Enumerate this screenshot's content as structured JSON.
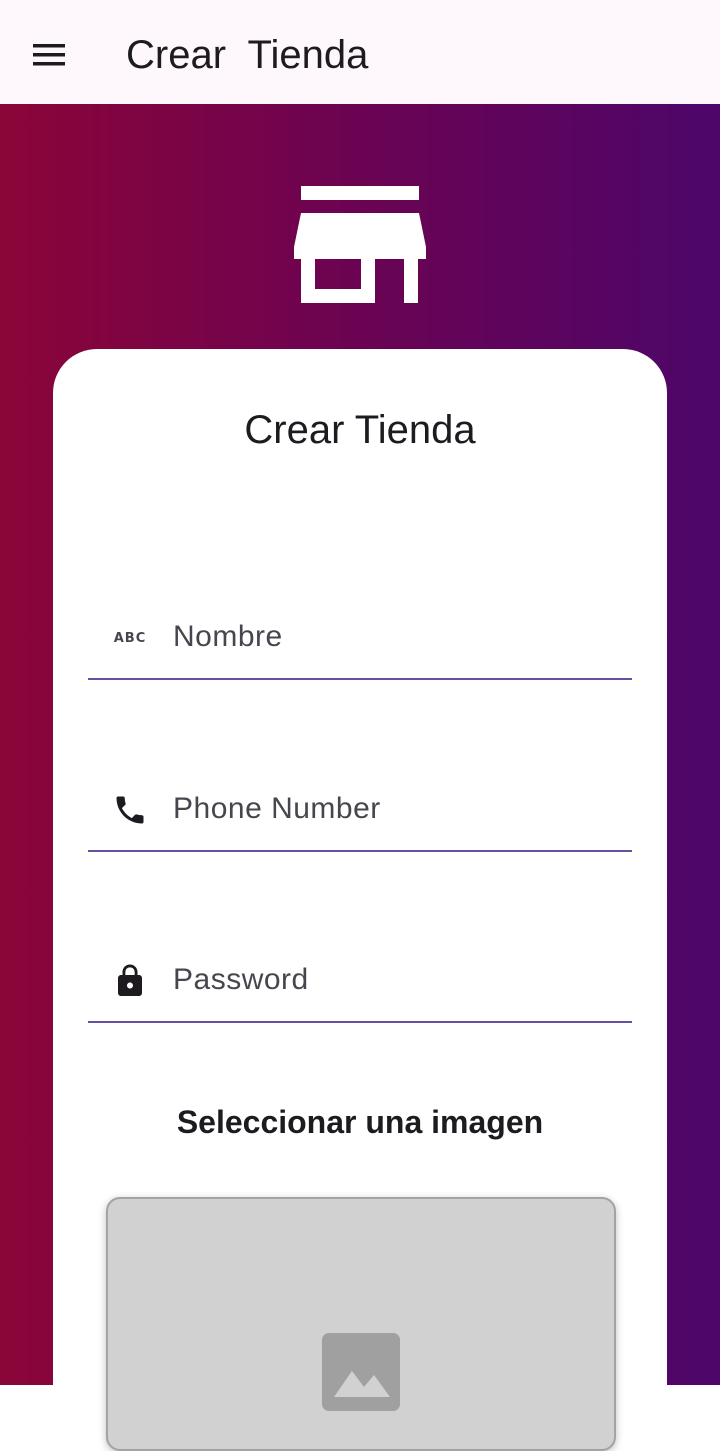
{
  "app_bar": {
    "title": "Crear  Tienda",
    "menu_icon": "menu-icon"
  },
  "header_icon": "store-icon",
  "card": {
    "title": "Crear Tienda",
    "fields": [
      {
        "icon": "abc-icon",
        "icon_text": "ABC",
        "placeholder": "Nombre"
      },
      {
        "icon": "phone-icon",
        "placeholder": "Phone Number"
      },
      {
        "icon": "lock-icon",
        "placeholder": "Password"
      }
    ],
    "image_section": {
      "heading": "Seleccionar una imagen",
      "placeholder_icon": "image-placeholder-icon"
    }
  },
  "colors": {
    "gradient_start": "#8b0538",
    "gradient_end": "#4d066a",
    "underline": "#6750a4",
    "app_bar_bg": "#fef7fc"
  }
}
